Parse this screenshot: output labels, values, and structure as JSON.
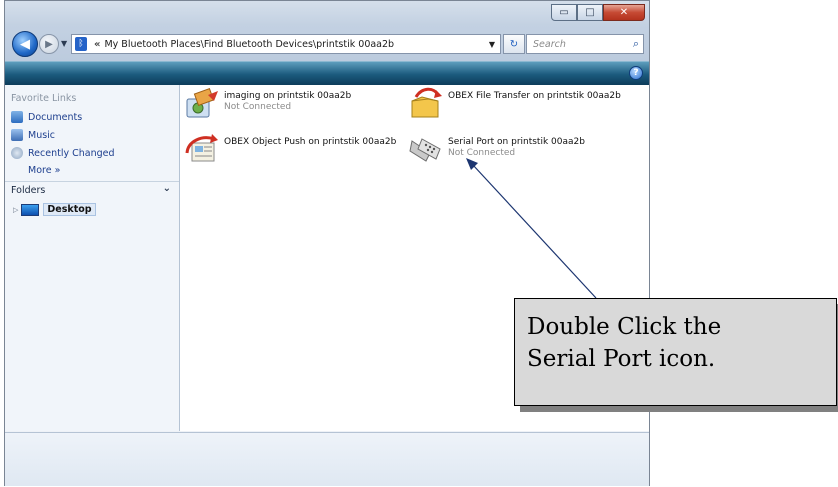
{
  "titlebar": {
    "caption_buttons": [
      "▭",
      "□",
      "✕"
    ]
  },
  "navigation": {
    "address_prefix": "«",
    "address_path": "My Bluetooth Places\\Find Bluetooth Devices\\printstik 00aa2b",
    "search_placeholder": "Search"
  },
  "nav_pane": {
    "favorites_title": "Favorite Links",
    "favorites": [
      {
        "label": "Documents",
        "icon": "documents-icon"
      },
      {
        "label": "Music",
        "icon": "music-icon"
      },
      {
        "label": "Recently Changed",
        "icon": "recently-changed-icon"
      }
    ],
    "more_label": "More »",
    "folders_label": "Folders",
    "tree": [
      {
        "label": "Desktop",
        "icon": "desktop-icon"
      }
    ]
  },
  "services": [
    {
      "name": "imaging on printstik 00aa2b",
      "status": "Not Connected",
      "icon": "imaging-icon"
    },
    {
      "name": "OBEX File Transfer on printstik 00aa2b",
      "status": "",
      "icon": "obex-file-transfer-icon"
    },
    {
      "name": "OBEX Object Push on printstik 00aa2b",
      "status": "",
      "icon": "obex-object-push-icon"
    },
    {
      "name": "Serial Port on printstik 00aa2b",
      "status": "Not Connected",
      "icon": "serial-port-icon"
    }
  ],
  "callout": {
    "line1": "Double Click the",
    "line2": "Serial Port icon."
  },
  "colors": {
    "toolbar": "#1b5a7d",
    "link": "#1e3f8e",
    "callout_bg": "#d9d9d9"
  }
}
